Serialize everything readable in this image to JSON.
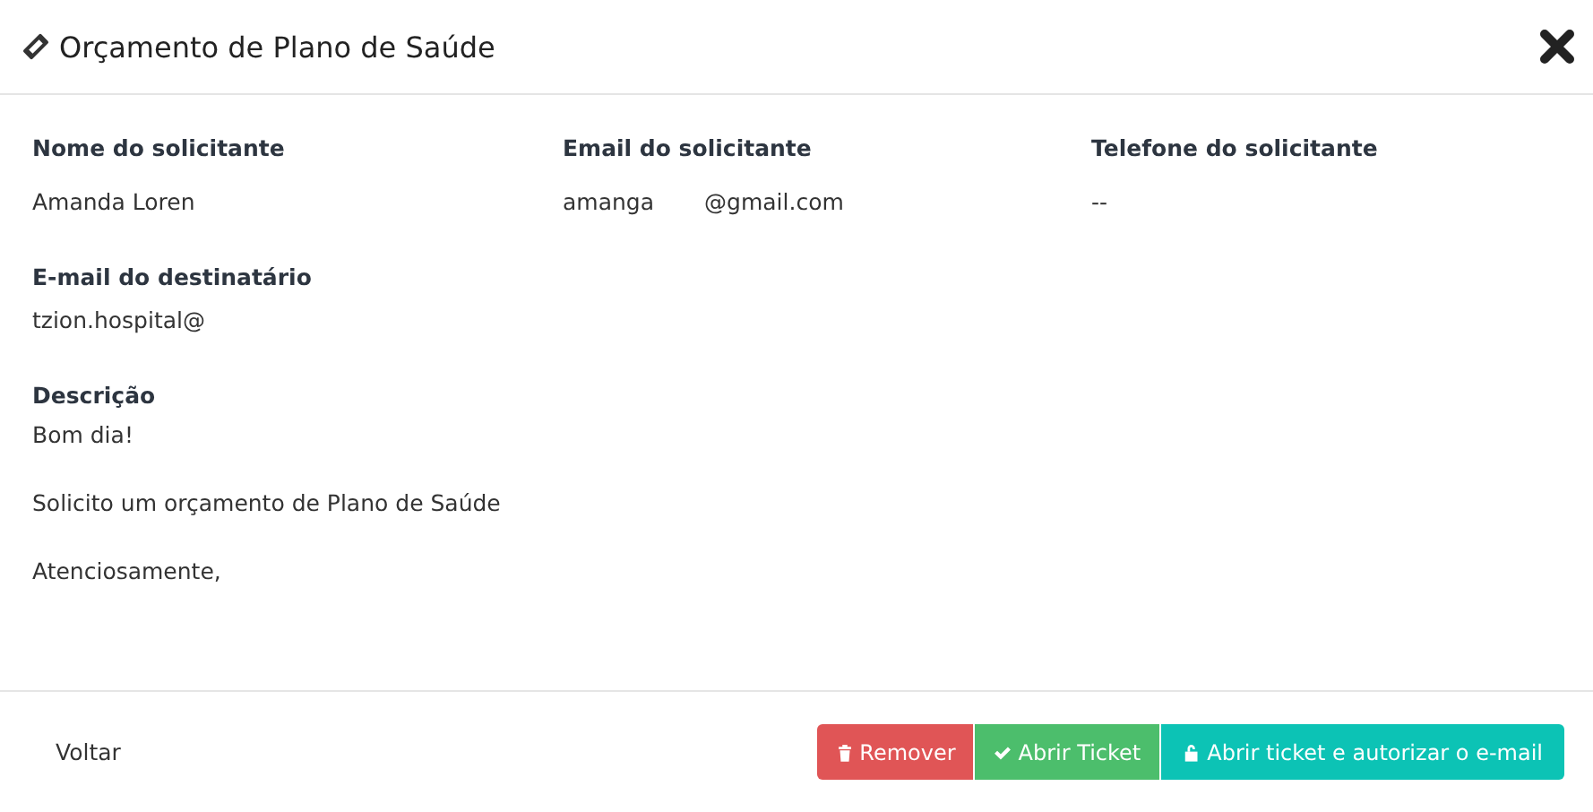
{
  "window": {
    "title": "Orçamento de Plano de Saúde"
  },
  "fields": [
    {
      "label": "Nome do solicitante",
      "values": [
        "Amanda Loren"
      ]
    },
    {
      "label": "Email do solicitante",
      "values": [
        "amanga",
        "@gmail.com"
      ]
    },
    {
      "label": "Telefone do solicitante",
      "values": [
        "--"
      ]
    }
  ],
  "recipient": {
    "label": "E-mail do destinatário",
    "value": "tzion.hospital@"
  },
  "description": {
    "label": "Descrição",
    "paragraphs": [
      "Bom dia!",
      "Solicito um orçamento de Plano de Saúde",
      "Atenciosamente,"
    ]
  },
  "footer": {
    "back": "Voltar",
    "buttons": [
      {
        "label": "Remover",
        "kind": "danger"
      },
      {
        "label": "Abrir Ticket",
        "kind": "success"
      },
      {
        "label": "Abrir ticket e autorizar o e-mail",
        "kind": "info"
      }
    ]
  }
}
